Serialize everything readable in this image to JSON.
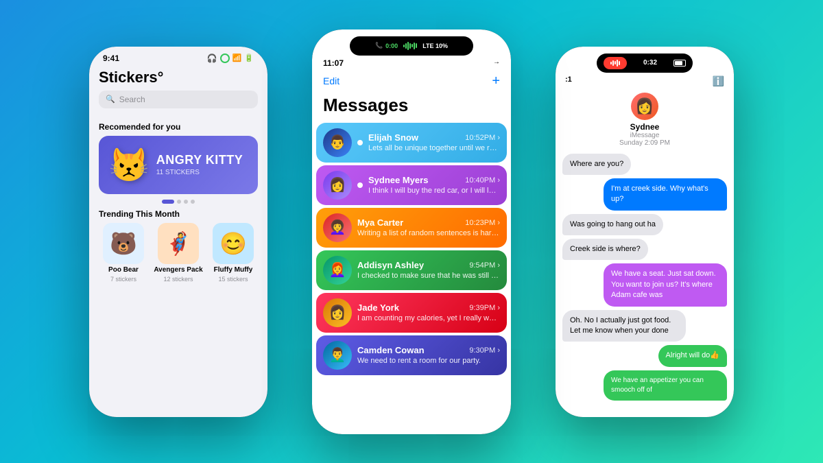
{
  "background": {
    "gradient": "linear-gradient(135deg, #1a8fe0 0%, #0abcd4 40%, #2ee8b5 100%)"
  },
  "left_phone": {
    "status_time": "9:41",
    "title": "Stickers°",
    "search_placeholder": "Search",
    "recommended_label": "Recomended for you",
    "featured": {
      "name": "ANGRY KITTY",
      "count": "11 STICKERS",
      "emoji": "😾"
    },
    "trending_label": "Trending This Month",
    "trending_items": [
      {
        "name": "Poo Bear",
        "count": "7 stickers",
        "emoji": "🐻",
        "bg": "#e0f0ff"
      },
      {
        "name": "Avengers Pack",
        "count": "12 stickers",
        "emoji": "🦸",
        "bg": "#ffe0c0"
      },
      {
        "name": "Fluffy Muffy",
        "count": "15 stickers",
        "emoji": "😊",
        "bg": "#c0e8ff"
      }
    ]
  },
  "center_phone": {
    "status_time": "11:07",
    "call_time": "0:00",
    "edit_label": "Edit",
    "plus_label": "+",
    "title": "Messages",
    "conversations": [
      {
        "name": "Elijah Snow",
        "time": "10:52PM",
        "preview": "Lets all be unique together until we realise we are all the same.",
        "color": "msg-teal",
        "unread": true
      },
      {
        "name": "Sydnee Myers",
        "time": "10:40PM",
        "preview": "I think I will buy the red car, or I will lease the blue one.",
        "color": "msg-purple",
        "unread": true
      },
      {
        "name": "Mya Carter",
        "time": "10:23PM",
        "preview": "Writing a list of random sentences is harder than I initially thought.",
        "color": "msg-orange",
        "unread": false
      },
      {
        "name": "Addisyn Ashley",
        "time": "9:54PM",
        "preview": "I checked to make sure that he was still alive.",
        "color": "msg-green",
        "unread": false
      },
      {
        "name": "Jade York",
        "time": "9:39PM",
        "preview": "I am counting my calories, yet I really want dessert.",
        "color": "msg-pink",
        "unread": false
      },
      {
        "name": "Camden Cowan",
        "time": "9:30PM",
        "preview": "We need to rent a room for our party.",
        "color": "msg-indigo",
        "unread": false
      }
    ]
  },
  "right_phone": {
    "status_time": "0:32",
    "contact_name": "Sydnee",
    "imessage_label": "iMessage",
    "timestamp": "Sunday 2:09 PM",
    "messages": [
      {
        "text": "Where are you?",
        "type": "received"
      },
      {
        "text": "I'm at creek side. Why what's up?",
        "type": "sent"
      },
      {
        "text": "Was going to hang out ha",
        "type": "received"
      },
      {
        "text": "Creek side is where?",
        "type": "received"
      },
      {
        "text": "We have a seat. Just sat down. You want to join us? It's where Adam cafe was",
        "type": "sent-purple"
      },
      {
        "text": "Oh. No I actually just got food. Let me know when your done",
        "type": "received"
      },
      {
        "text": "Alright will do👍",
        "type": "sent-green"
      },
      {
        "text": "We have an appetizer you can smooch off of",
        "type": "sent-green"
      }
    ]
  }
}
